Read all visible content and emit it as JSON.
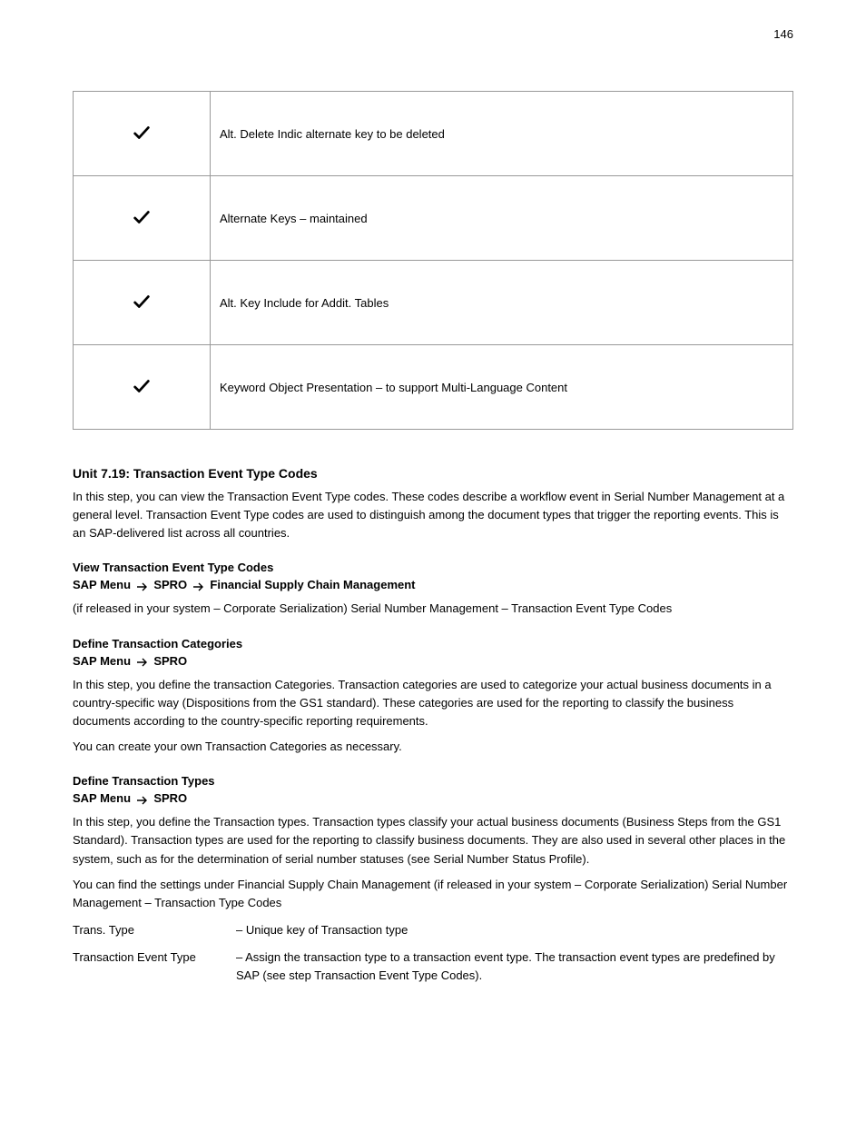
{
  "page_number": "146",
  "table": {
    "rows": [
      {
        "checked": true,
        "text": "Alt. Delete Indic alternate key to be deleted"
      },
      {
        "checked": true,
        "text": "Alternate Keys – maintained"
      },
      {
        "checked": true,
        "text": "Alt. Key Include for Addit. Tables"
      },
      {
        "checked": true,
        "text": "Keyword Object Presentation – to support Multi-Language Content"
      }
    ]
  },
  "unit": {
    "heading": "Unit 7.19: Transaction Event Type Codes",
    "intro": "In this step, you can view the Transaction Event Type codes. These codes describe a workflow event in Serial Number Management at a general level. Transaction Event Type codes are used to distinguish among the document types that trigger the reporting events. This is an SAP-delivered list across all countries.",
    "block1": {
      "title": "View Transaction Event Type Codes",
      "nav_prefix": "SAP Menu",
      "nav_segments": [
        "SPRO",
        "Financial Supply Chain Management"
      ],
      "para": "(if released in your system – Corporate Serialization) Serial Number Management – Transaction Event Type Codes"
    },
    "block2": {
      "title": "Define Transaction Categories",
      "nav_prefix": "SAP Menu",
      "nav_segments": [
        "SPRO"
      ],
      "para1": "In this step, you define the transaction Categories. Transaction categories are used to categorize your actual business documents in a country-specific way (Dispositions from the GS1 standard). These categories are used for the reporting to classify the business documents according to the country-specific reporting requirements.",
      "para2": "You can create your own Transaction Categories as necessary."
    },
    "block3": {
      "title": "Define Transaction Types",
      "nav_prefix": "SAP Menu",
      "nav_segments": [
        "SPRO"
      ],
      "para1": "In this step, you define the Transaction types. Transaction types classify your actual business documents (Business Steps from the GS1 Standard). Transaction types are used for the reporting to classify business documents. They are also used in several other places in the system, such as for the determination of serial number statuses (see Serial Number Status Profile).",
      "para2": "You can find the settings under Financial Supply Chain Management (if released in your system – Corporate Serialization) Serial Number Management – Transaction Type Codes"
    },
    "fields": [
      {
        "label": "Trans. Type",
        "desc": "– Unique key of Transaction type"
      },
      {
        "label": "Transaction Event Type",
        "desc": "– Assign the transaction type to a transaction event type. The transaction event types are predefined by SAP (see step Transaction Event Type Codes)."
      }
    ]
  }
}
